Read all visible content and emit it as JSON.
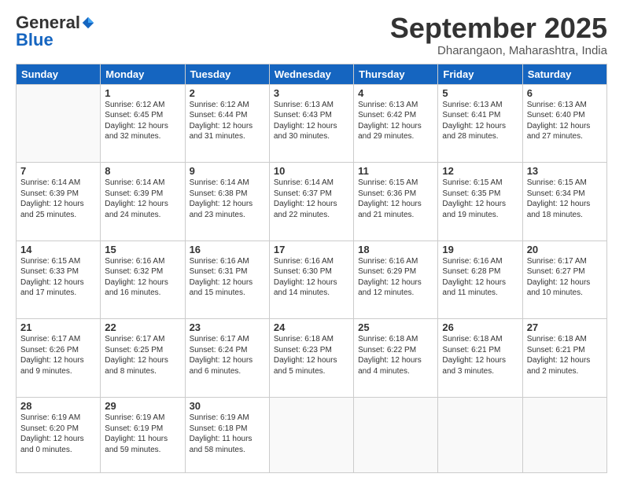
{
  "logo": {
    "general": "General",
    "blue": "Blue"
  },
  "title": "September 2025",
  "location": "Dharangaon, Maharashtra, India",
  "days": [
    "Sunday",
    "Monday",
    "Tuesday",
    "Wednesday",
    "Thursday",
    "Friday",
    "Saturday"
  ],
  "weeks": [
    [
      {
        "day": "",
        "info": ""
      },
      {
        "day": "1",
        "info": "Sunrise: 6:12 AM\nSunset: 6:45 PM\nDaylight: 12 hours\nand 32 minutes."
      },
      {
        "day": "2",
        "info": "Sunrise: 6:12 AM\nSunset: 6:44 PM\nDaylight: 12 hours\nand 31 minutes."
      },
      {
        "day": "3",
        "info": "Sunrise: 6:13 AM\nSunset: 6:43 PM\nDaylight: 12 hours\nand 30 minutes."
      },
      {
        "day": "4",
        "info": "Sunrise: 6:13 AM\nSunset: 6:42 PM\nDaylight: 12 hours\nand 29 minutes."
      },
      {
        "day": "5",
        "info": "Sunrise: 6:13 AM\nSunset: 6:41 PM\nDaylight: 12 hours\nand 28 minutes."
      },
      {
        "day": "6",
        "info": "Sunrise: 6:13 AM\nSunset: 6:40 PM\nDaylight: 12 hours\nand 27 minutes."
      }
    ],
    [
      {
        "day": "7",
        "info": "Sunrise: 6:14 AM\nSunset: 6:39 PM\nDaylight: 12 hours\nand 25 minutes."
      },
      {
        "day": "8",
        "info": "Sunrise: 6:14 AM\nSunset: 6:39 PM\nDaylight: 12 hours\nand 24 minutes."
      },
      {
        "day": "9",
        "info": "Sunrise: 6:14 AM\nSunset: 6:38 PM\nDaylight: 12 hours\nand 23 minutes."
      },
      {
        "day": "10",
        "info": "Sunrise: 6:14 AM\nSunset: 6:37 PM\nDaylight: 12 hours\nand 22 minutes."
      },
      {
        "day": "11",
        "info": "Sunrise: 6:15 AM\nSunset: 6:36 PM\nDaylight: 12 hours\nand 21 minutes."
      },
      {
        "day": "12",
        "info": "Sunrise: 6:15 AM\nSunset: 6:35 PM\nDaylight: 12 hours\nand 19 minutes."
      },
      {
        "day": "13",
        "info": "Sunrise: 6:15 AM\nSunset: 6:34 PM\nDaylight: 12 hours\nand 18 minutes."
      }
    ],
    [
      {
        "day": "14",
        "info": "Sunrise: 6:15 AM\nSunset: 6:33 PM\nDaylight: 12 hours\nand 17 minutes."
      },
      {
        "day": "15",
        "info": "Sunrise: 6:16 AM\nSunset: 6:32 PM\nDaylight: 12 hours\nand 16 minutes."
      },
      {
        "day": "16",
        "info": "Sunrise: 6:16 AM\nSunset: 6:31 PM\nDaylight: 12 hours\nand 15 minutes."
      },
      {
        "day": "17",
        "info": "Sunrise: 6:16 AM\nSunset: 6:30 PM\nDaylight: 12 hours\nand 14 minutes."
      },
      {
        "day": "18",
        "info": "Sunrise: 6:16 AM\nSunset: 6:29 PM\nDaylight: 12 hours\nand 12 minutes."
      },
      {
        "day": "19",
        "info": "Sunrise: 6:16 AM\nSunset: 6:28 PM\nDaylight: 12 hours\nand 11 minutes."
      },
      {
        "day": "20",
        "info": "Sunrise: 6:17 AM\nSunset: 6:27 PM\nDaylight: 12 hours\nand 10 minutes."
      }
    ],
    [
      {
        "day": "21",
        "info": "Sunrise: 6:17 AM\nSunset: 6:26 PM\nDaylight: 12 hours\nand 9 minutes."
      },
      {
        "day": "22",
        "info": "Sunrise: 6:17 AM\nSunset: 6:25 PM\nDaylight: 12 hours\nand 8 minutes."
      },
      {
        "day": "23",
        "info": "Sunrise: 6:17 AM\nSunset: 6:24 PM\nDaylight: 12 hours\nand 6 minutes."
      },
      {
        "day": "24",
        "info": "Sunrise: 6:18 AM\nSunset: 6:23 PM\nDaylight: 12 hours\nand 5 minutes."
      },
      {
        "day": "25",
        "info": "Sunrise: 6:18 AM\nSunset: 6:22 PM\nDaylight: 12 hours\nand 4 minutes."
      },
      {
        "day": "26",
        "info": "Sunrise: 6:18 AM\nSunset: 6:21 PM\nDaylight: 12 hours\nand 3 minutes."
      },
      {
        "day": "27",
        "info": "Sunrise: 6:18 AM\nSunset: 6:21 PM\nDaylight: 12 hours\nand 2 minutes."
      }
    ],
    [
      {
        "day": "28",
        "info": "Sunrise: 6:19 AM\nSunset: 6:20 PM\nDaylight: 12 hours\nand 0 minutes."
      },
      {
        "day": "29",
        "info": "Sunrise: 6:19 AM\nSunset: 6:19 PM\nDaylight: 11 hours\nand 59 minutes."
      },
      {
        "day": "30",
        "info": "Sunrise: 6:19 AM\nSunset: 6:18 PM\nDaylight: 11 hours\nand 58 minutes."
      },
      {
        "day": "",
        "info": ""
      },
      {
        "day": "",
        "info": ""
      },
      {
        "day": "",
        "info": ""
      },
      {
        "day": "",
        "info": ""
      }
    ]
  ]
}
